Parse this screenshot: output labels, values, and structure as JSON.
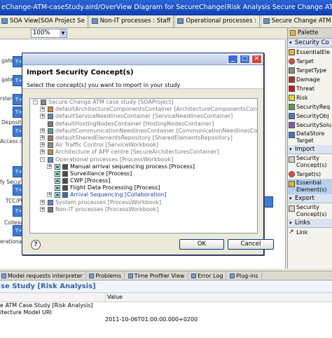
{
  "app": {
    "title": "eChange-ATM-caseStudy.aird/OverView Diagram for SecureChange(Risk Analysis Secure Change ATM cas"
  },
  "editor_tabs": [
    {
      "label": "SOA View(SOA Project Se"
    },
    {
      "label": "Non-IT processes : Staff"
    },
    {
      "label": "Operational processes :"
    },
    {
      "label": "Secure Change ATM case s"
    }
  ],
  "zoom": {
    "value": "100%"
  },
  "canvas": {
    "node_label": "T+I",
    "labels": [
      "gate",
      "gate",
      "rsten",
      "Deposit re",
      "Access cont",
      "fy Security",
      "TCC/PL",
      "Colleague",
      "erational pr"
    ]
  },
  "palette": {
    "title": "Palette",
    "sections": [
      {
        "label": "Security Co",
        "items": [
          "EssentialEle",
          "Target",
          "TargetType",
          "Damage",
          "Threat",
          "Risk",
          "SecurityReq",
          "SecurityObj",
          "SecuritySolu",
          "DataStore Target"
        ]
      },
      {
        "label": "Import",
        "items": [
          "Security Concept(s)",
          "Target(s)",
          "Essential Element(s)"
        ]
      },
      {
        "label": "Export",
        "items": [
          "Security Concept(s)"
        ]
      },
      {
        "label": "Links",
        "items": [
          "Link"
        ]
      }
    ]
  },
  "dialog": {
    "title": "Import Security Concept(s)",
    "subtitle": "Select the concept(s) you want to import in your study",
    "tree": [
      {
        "label": "Secure Change ATM case study [SOAProject]",
        "indent": 0,
        "exp": "-",
        "style": "gray"
      },
      {
        "label": "defaultArchitectureComponentsContainer [ArchitectureComponentsContainer]",
        "indent": 1,
        "exp": "+",
        "style": "gray"
      },
      {
        "label": "defaultServiceNeedlinesContainer [ServiceNeedlinesContainer]",
        "indent": 1,
        "exp": "+",
        "style": "gray"
      },
      {
        "label": "defaultHostingNodesContainer [HostingNodesContainer]",
        "indent": 1,
        "exp": "",
        "style": "gray"
      },
      {
        "label": "defaultCommunicationNeedlinesContainer [CommunicationNeedlinesContainer]",
        "indent": 1,
        "exp": "+",
        "style": "gray"
      },
      {
        "label": "defaultSharedElementsRepository [SharedElementsRepository]",
        "indent": 1,
        "exp": "+",
        "style": "gray"
      },
      {
        "label": "Air Traffic Control [ServiceWorkbook]",
        "indent": 1,
        "exp": "+",
        "style": "gray"
      },
      {
        "label": "Architecture of APP centre [SecureArchitecturesContainer]",
        "indent": 1,
        "exp": "+",
        "style": "gray"
      },
      {
        "label": "Operational processes [ProcessWorkbook]",
        "indent": 1,
        "exp": "-",
        "style": "gray"
      },
      {
        "label": "Manual arrival sequencing process [Process]",
        "indent": 2,
        "exp": "+",
        "style": "normal",
        "checked": true
      },
      {
        "label": "Surveillance [Process]",
        "indent": 2,
        "exp": "",
        "style": "normal",
        "checked": true
      },
      {
        "label": "CWP [Process]",
        "indent": 2,
        "exp": "",
        "style": "normal",
        "checked": true
      },
      {
        "label": "Flight Data Processing [Process]",
        "indent": 2,
        "exp": "",
        "style": "normal",
        "checked": true
      },
      {
        "label": "Arrival Sequencing [Collaboration]",
        "indent": 2,
        "exp": "+",
        "style": "blue",
        "checked": true
      },
      {
        "label": "System processes [ProcessWorkbook]",
        "indent": 1,
        "exp": "+",
        "style": "gray"
      },
      {
        "label": "Non-IT processes [ProcessWorkbook]",
        "indent": 1,
        "exp": "+",
        "style": "gray"
      }
    ],
    "help_label": "?",
    "ok_label": "OK",
    "cancel_label": "Cancel"
  },
  "bottom_tabs": [
    {
      "label": "Model requests interpreter"
    },
    {
      "label": "Problems"
    },
    {
      "label": "Time Profiler View"
    },
    {
      "label": "Error Log"
    },
    {
      "label": "Plug-ins"
    }
  ],
  "properties": {
    "title": "se Study [Risk Analysis]",
    "value_header": "Value",
    "rows": [
      {
        "prop": "e ATM Case Study [Risk Analysis]",
        "value": ""
      },
      {
        "prop": "itecture Model URI",
        "value": ""
      },
      {
        "prop": "",
        "value": "2011-10-06T01:00:00.000+0200"
      }
    ]
  }
}
